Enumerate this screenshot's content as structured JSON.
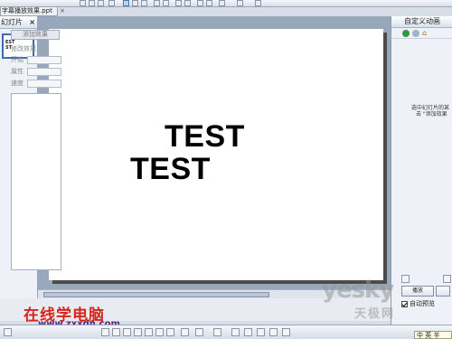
{
  "document": {
    "tab_title": "字幕播放效果.ppt",
    "tab_close": "×"
  },
  "slides_pane": {
    "header": "幻灯片",
    "close": "×",
    "thumbnail_line1": "EST",
    "thumbnail_line2": "ST"
  },
  "slide": {
    "text_line1": "TEST",
    "text_line2": "TEST"
  },
  "task_pane": {
    "title": "自定义动画",
    "add_effect": "添加效果",
    "modify_label": "修改效果",
    "start_label": "开始",
    "property_label": "属性",
    "speed_label": "速度",
    "hint_line1": "选中幻灯片的某",
    "hint_line2": "击 \"添加效果",
    "play_button": "播放",
    "autopreview_label": "自动预览"
  },
  "watermarks": {
    "left_title": "在线学电脑",
    "left_url": "www.zxxdn.com",
    "right_logo": "yesky",
    "right_sub": "天极网"
  },
  "status": {
    "ime": "中 英 半"
  }
}
